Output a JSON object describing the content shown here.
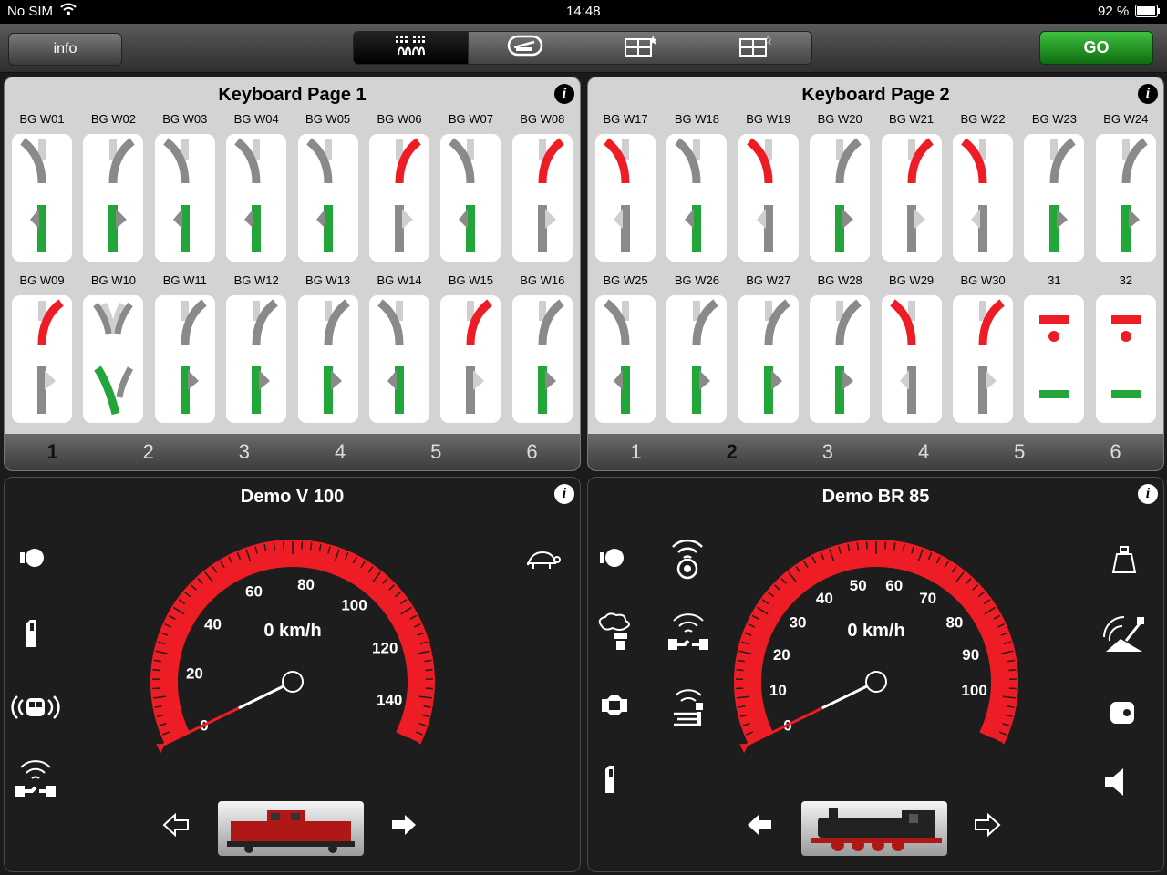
{
  "status": {
    "carrier": "No SIM",
    "time": "14:48",
    "battery": "92 %"
  },
  "toolbar": {
    "info_label": "info",
    "go_label": "GO",
    "tabs": [
      "keyboard-icon",
      "locomotive-icon",
      "layout-star-icon",
      "layout-star2-icon"
    ]
  },
  "keyboards": [
    {
      "title": "Keyboard Page 1",
      "pages": [
        "1",
        "2",
        "3",
        "4",
        "5",
        "6"
      ],
      "current_page": "1",
      "cells": [
        {
          "label": "BG W01",
          "kind": "left",
          "state": "straight"
        },
        {
          "label": "BG W02",
          "kind": "right",
          "state": "straight"
        },
        {
          "label": "BG W03",
          "kind": "left",
          "state": "straight"
        },
        {
          "label": "BG W04",
          "kind": "left",
          "state": "straight"
        },
        {
          "label": "BG W05",
          "kind": "left",
          "state": "straight"
        },
        {
          "label": "BG W06",
          "kind": "right",
          "state": "turn"
        },
        {
          "label": "BG W07",
          "kind": "left",
          "state": "straight"
        },
        {
          "label": "BG W08",
          "kind": "right",
          "state": "turn"
        },
        {
          "label": "BG W09",
          "kind": "right",
          "state": "turn"
        },
        {
          "label": "BG W10",
          "kind": "double",
          "state": "turn"
        },
        {
          "label": "BG W11",
          "kind": "right",
          "state": "straight"
        },
        {
          "label": "BG W12",
          "kind": "right",
          "state": "straight"
        },
        {
          "label": "BG W13",
          "kind": "right",
          "state": "straight"
        },
        {
          "label": "BG W14",
          "kind": "left",
          "state": "straight"
        },
        {
          "label": "BG W15",
          "kind": "right",
          "state": "turn"
        },
        {
          "label": "BG W16",
          "kind": "right",
          "state": "straight"
        }
      ]
    },
    {
      "title": "Keyboard Page 2",
      "pages": [
        "1",
        "2",
        "3",
        "4",
        "5",
        "6"
      ],
      "current_page": "2",
      "cells": [
        {
          "label": "BG W17",
          "kind": "left",
          "state": "turn"
        },
        {
          "label": "BG W18",
          "kind": "left",
          "state": "straight"
        },
        {
          "label": "BG W19",
          "kind": "left",
          "state": "turn"
        },
        {
          "label": "BG W20",
          "kind": "right",
          "state": "straight"
        },
        {
          "label": "BG W21",
          "kind": "right",
          "state": "turn"
        },
        {
          "label": "BG W22",
          "kind": "left",
          "state": "turn"
        },
        {
          "label": "BG W23",
          "kind": "right",
          "state": "straight"
        },
        {
          "label": "BG W24",
          "kind": "right",
          "state": "straight"
        },
        {
          "label": "BG W25",
          "kind": "left",
          "state": "straight"
        },
        {
          "label": "BG W26",
          "kind": "right",
          "state": "straight"
        },
        {
          "label": "BG W27",
          "kind": "right",
          "state": "straight"
        },
        {
          "label": "BG W28",
          "kind": "right",
          "state": "straight"
        },
        {
          "label": "BG W29",
          "kind": "left",
          "state": "turn"
        },
        {
          "label": "BG W30",
          "kind": "right",
          "state": "turn"
        },
        {
          "label": "31",
          "kind": "signal",
          "state": "stop"
        },
        {
          "label": "32",
          "kind": "signal",
          "state": "stop"
        }
      ]
    }
  ],
  "locos": [
    {
      "name": "Demo V 100",
      "speed_text": "0 km/h",
      "speed": 0,
      "max": 150,
      "ticks": [
        "0",
        "20",
        "40",
        "60",
        "80",
        "100",
        "120",
        "140"
      ],
      "tick_values": [
        0,
        20,
        40,
        60,
        80,
        100,
        120,
        140
      ],
      "direction": "backward",
      "image": "diesel-locomotive-image"
    },
    {
      "name": "Demo BR 85",
      "speed_text": "0 km/h",
      "speed": 0,
      "max": 110,
      "ticks": [
        "0",
        "10",
        "20",
        "30",
        "40",
        "50",
        "60",
        "70",
        "80",
        "90",
        "100"
      ],
      "tick_values": [
        0,
        10,
        20,
        30,
        40,
        50,
        60,
        70,
        80,
        90,
        100
      ],
      "direction": "forward",
      "image": "steam-locomotive-image"
    }
  ],
  "colors": {
    "red": "#ee1c25",
    "green": "#22a539",
    "gray": "#8a8a8a"
  }
}
